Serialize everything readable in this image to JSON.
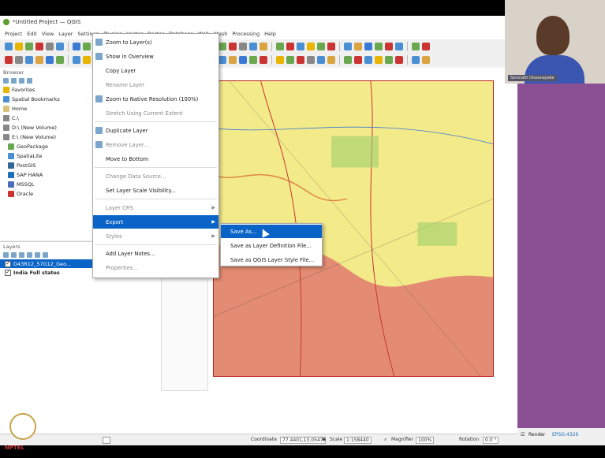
{
  "window_title": "*Untitled Project — QGIS",
  "menu": [
    "Project",
    "Edit",
    "View",
    "Layer",
    "Settings",
    "Plugins",
    "Vector",
    "Raster",
    "Database",
    "Web",
    "Mesh",
    "Processing",
    "Help"
  ],
  "browser": {
    "title": "Browser",
    "items": [
      {
        "label": "Favorites",
        "icon": "star-icon",
        "color": "#e8b400"
      },
      {
        "label": "Spatial Bookmarks",
        "icon": "bookmark-icon",
        "color": "#4a8fd4"
      },
      {
        "label": "Home",
        "icon": "folder-icon",
        "color": "#d9c27a"
      },
      {
        "label": "C:\\",
        "icon": "drive-icon",
        "color": "#888"
      },
      {
        "label": "D:\\ (New Volume)",
        "icon": "drive-icon",
        "color": "#888"
      },
      {
        "label": "E:\\ (New Volume)",
        "icon": "drive-icon",
        "color": "#888"
      },
      {
        "label": "GeoPackage",
        "icon": "geopackage-icon",
        "color": "#6aa84f"
      },
      {
        "label": "SpatiaLite",
        "icon": "spatialite-icon",
        "color": "#4a8fd4"
      },
      {
        "label": "PostGIS",
        "icon": "postgis-icon",
        "color": "#336699"
      },
      {
        "label": "SAP HANA",
        "icon": "saphana-icon",
        "color": "#1d6fb8"
      },
      {
        "label": "MSSQL",
        "icon": "mssql-icon",
        "color": "#4a6fb8"
      },
      {
        "label": "Oracle",
        "icon": "oracle-icon",
        "color": "#c33"
      }
    ]
  },
  "layers": {
    "title": "Layers",
    "items": [
      {
        "label": "D43R12_57G12_Geo...",
        "checked": true,
        "selected": true
      },
      {
        "label": "India Full states",
        "checked": true,
        "selected": false
      }
    ]
  },
  "context_menu": [
    {
      "label": "Zoom to Layer(s)",
      "dim": false,
      "icon": true
    },
    {
      "label": "Show in Overview",
      "dim": false,
      "icon": true
    },
    {
      "label": "Copy Layer",
      "dim": false
    },
    {
      "label": "Rename Layer",
      "dim": true
    },
    {
      "label": "Zoom to Native Resolution (100%)",
      "dim": false,
      "icon": true
    },
    {
      "label": "Stretch Using Current Extent",
      "dim": true
    },
    {
      "label": "Duplicate Layer",
      "dim": false,
      "icon": true
    },
    {
      "label": "Remove Layer...",
      "dim": true,
      "icon": true
    },
    {
      "label": "Move to Bottom",
      "dim": false
    },
    {
      "label": "Change Data Source...",
      "dim": true
    },
    {
      "label": "Set Layer Scale Visibility...",
      "dim": false
    },
    {
      "label": "Layer CRS",
      "dim": true,
      "submenu": true
    },
    {
      "label": "Export",
      "dim": false,
      "submenu": true,
      "active": true
    },
    {
      "label": "Styles",
      "dim": true,
      "submenu": true
    },
    {
      "label": "Add Layer Notes...",
      "dim": false
    },
    {
      "label": "Properties...",
      "dim": true
    }
  ],
  "export_submenu": [
    {
      "label": "Save As...",
      "active": true
    },
    {
      "label": "Save as Layer Definition File...",
      "active": false
    },
    {
      "label": "Save as QGIS Layer Style File...",
      "active": false
    }
  ],
  "status": {
    "coordinate_label": "Coordinate",
    "coordinate_value": "77.4401,13.0547",
    "scale_label": "Scale",
    "scale_value": "1:158440",
    "magnifier_label": "Magnifier",
    "magnifier_value": "100%",
    "rotation_label": "Rotation",
    "rotation_value": "0.0 °",
    "render_label": "Render",
    "crs_label": "EPSG:4326"
  },
  "presenter_tag": "Somnath Dissanayake",
  "nptel_label": "NPTEL",
  "colors": {
    "highlight": "#0a64c8",
    "purple": "#8b4f94",
    "map_yellow": "#f3ea8a",
    "map_red": "#e07b6e"
  }
}
